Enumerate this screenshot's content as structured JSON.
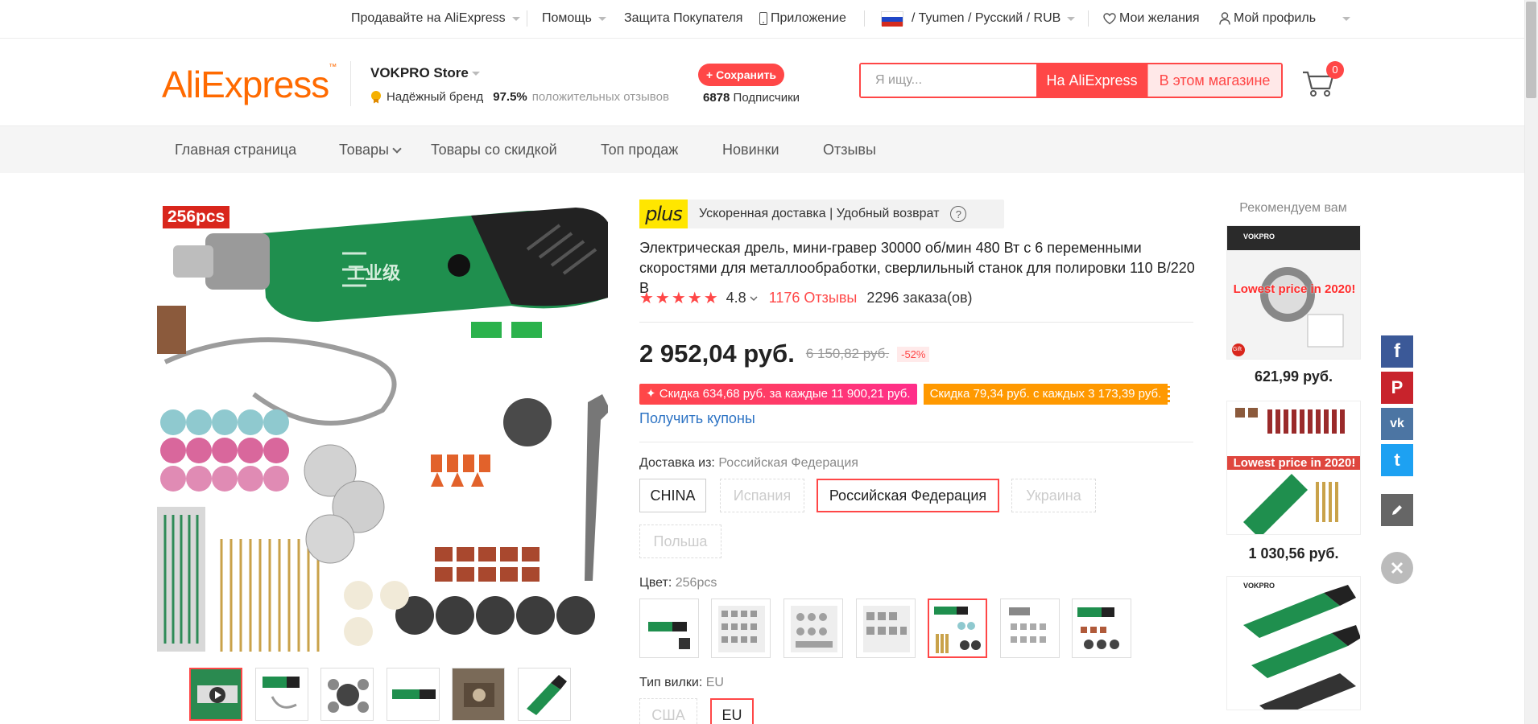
{
  "topbar": {
    "sell": "Продавайте на AliExpress",
    "help": "Помощь",
    "protection": "Защита Покупателя",
    "app": "Приложение",
    "locale": "/ Tyumen / Русский /  RUB",
    "wishlist": "Мои желания",
    "profile": "Мой профиль"
  },
  "header": {
    "logo": "AliExpress",
    "store_name": "VOKPRO Store",
    "brand_label": "Надёжный бренд",
    "positive_pct": "97.5%",
    "positive_text": "положительных отзывов",
    "save_button": "+ Сохранить",
    "subscribers_count": "6878",
    "subscribers_label": "Подписчики",
    "search_placeholder": "Я ищу...",
    "search_ali_button": "На AliExpress",
    "search_store_button": "В этом магазине",
    "cart_count": "0"
  },
  "nav": {
    "items": [
      "Главная страница",
      "Товары",
      "Товары со скидкой",
      "Топ продаж",
      "Новинки",
      "Отзывы"
    ]
  },
  "gallery": {
    "badge": "256pcs",
    "brand_text": "工业级",
    "thumb_count": 6
  },
  "product": {
    "plus_logo": "plus",
    "plus_text": "Ускоренная доставка | Удобный возврат",
    "help": "?",
    "title": "Электрическая дрель, мини-гравер 30000 об/мин 480 Вт с 6 переменными скоростями для металлообработки, сверлильный станок для полировки 110 В/220 В",
    "stars": "★★★★★",
    "rating": "4.8",
    "reviews": "1176 Отзывы",
    "orders": "2296 заказа(ов)",
    "price": "2 952,04 руб.",
    "old_price": "6 150,82 руб.",
    "discount": "-52%",
    "promo1": "✦ Скидка 634,68 руб. за каждые 11 900,21 руб.",
    "promo2": "Скидка 79,34 руб. с каждых 3 173,39 руб.",
    "coupons": "Получить купоны",
    "ship_label": "Доставка из:",
    "ship_value": "Российская Федерация",
    "ship_options": [
      "CHINA",
      "Испания",
      "Российская Федерация",
      "Украина",
      "Польша"
    ],
    "color_label": "Цвет:",
    "color_value": "256pcs",
    "plug_label": "Тип вилки:",
    "plug_value": "EU",
    "plug_options": [
      "США",
      "EU"
    ]
  },
  "recommend": {
    "title": "Рекомендуем вам",
    "overlay": "Lowest price in 2020!",
    "brand": "VOKPRO",
    "gift": "Gift",
    "prices": [
      "621,99 руб.",
      "1 030,56 руб."
    ]
  },
  "social": {
    "facebook": "f",
    "pinterest": "P",
    "vk": "vk",
    "twitter": "t"
  },
  "colors": {
    "accent": "#ff4747",
    "logo": "#ff6a00",
    "link": "#2e74c4",
    "plus_yellow": "#ffe600",
    "drill_green": "#1f8f4e"
  }
}
